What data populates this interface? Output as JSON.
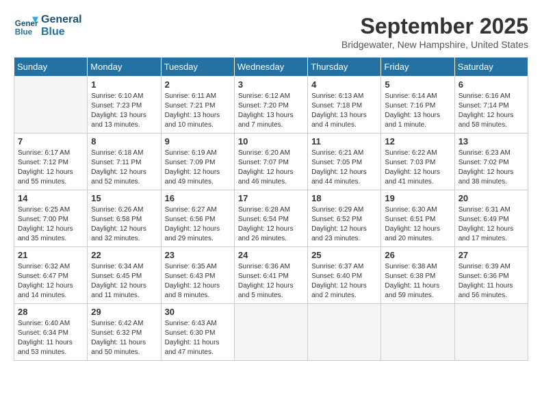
{
  "logo": {
    "line1": "General",
    "line2": "Blue"
  },
  "title": "September 2025",
  "location": "Bridgewater, New Hampshire, United States",
  "days_of_week": [
    "Sunday",
    "Monday",
    "Tuesday",
    "Wednesday",
    "Thursday",
    "Friday",
    "Saturday"
  ],
  "weeks": [
    [
      {
        "day": "",
        "info": ""
      },
      {
        "day": "1",
        "info": "Sunrise: 6:10 AM\nSunset: 7:23 PM\nDaylight: 13 hours\nand 13 minutes."
      },
      {
        "day": "2",
        "info": "Sunrise: 6:11 AM\nSunset: 7:21 PM\nDaylight: 13 hours\nand 10 minutes."
      },
      {
        "day": "3",
        "info": "Sunrise: 6:12 AM\nSunset: 7:20 PM\nDaylight: 13 hours\nand 7 minutes."
      },
      {
        "day": "4",
        "info": "Sunrise: 6:13 AM\nSunset: 7:18 PM\nDaylight: 13 hours\nand 4 minutes."
      },
      {
        "day": "5",
        "info": "Sunrise: 6:14 AM\nSunset: 7:16 PM\nDaylight: 13 hours\nand 1 minute."
      },
      {
        "day": "6",
        "info": "Sunrise: 6:16 AM\nSunset: 7:14 PM\nDaylight: 12 hours\nand 58 minutes."
      }
    ],
    [
      {
        "day": "7",
        "info": "Sunrise: 6:17 AM\nSunset: 7:12 PM\nDaylight: 12 hours\nand 55 minutes."
      },
      {
        "day": "8",
        "info": "Sunrise: 6:18 AM\nSunset: 7:11 PM\nDaylight: 12 hours\nand 52 minutes."
      },
      {
        "day": "9",
        "info": "Sunrise: 6:19 AM\nSunset: 7:09 PM\nDaylight: 12 hours\nand 49 minutes."
      },
      {
        "day": "10",
        "info": "Sunrise: 6:20 AM\nSunset: 7:07 PM\nDaylight: 12 hours\nand 46 minutes."
      },
      {
        "day": "11",
        "info": "Sunrise: 6:21 AM\nSunset: 7:05 PM\nDaylight: 12 hours\nand 44 minutes."
      },
      {
        "day": "12",
        "info": "Sunrise: 6:22 AM\nSunset: 7:03 PM\nDaylight: 12 hours\nand 41 minutes."
      },
      {
        "day": "13",
        "info": "Sunrise: 6:23 AM\nSunset: 7:02 PM\nDaylight: 12 hours\nand 38 minutes."
      }
    ],
    [
      {
        "day": "14",
        "info": "Sunrise: 6:25 AM\nSunset: 7:00 PM\nDaylight: 12 hours\nand 35 minutes."
      },
      {
        "day": "15",
        "info": "Sunrise: 6:26 AM\nSunset: 6:58 PM\nDaylight: 12 hours\nand 32 minutes."
      },
      {
        "day": "16",
        "info": "Sunrise: 6:27 AM\nSunset: 6:56 PM\nDaylight: 12 hours\nand 29 minutes."
      },
      {
        "day": "17",
        "info": "Sunrise: 6:28 AM\nSunset: 6:54 PM\nDaylight: 12 hours\nand 26 minutes."
      },
      {
        "day": "18",
        "info": "Sunrise: 6:29 AM\nSunset: 6:52 PM\nDaylight: 12 hours\nand 23 minutes."
      },
      {
        "day": "19",
        "info": "Sunrise: 6:30 AM\nSunset: 6:51 PM\nDaylight: 12 hours\nand 20 minutes."
      },
      {
        "day": "20",
        "info": "Sunrise: 6:31 AM\nSunset: 6:49 PM\nDaylight: 12 hours\nand 17 minutes."
      }
    ],
    [
      {
        "day": "21",
        "info": "Sunrise: 6:32 AM\nSunset: 6:47 PM\nDaylight: 12 hours\nand 14 minutes."
      },
      {
        "day": "22",
        "info": "Sunrise: 6:34 AM\nSunset: 6:45 PM\nDaylight: 12 hours\nand 11 minutes."
      },
      {
        "day": "23",
        "info": "Sunrise: 6:35 AM\nSunset: 6:43 PM\nDaylight: 12 hours\nand 8 minutes."
      },
      {
        "day": "24",
        "info": "Sunrise: 6:36 AM\nSunset: 6:41 PM\nDaylight: 12 hours\nand 5 minutes."
      },
      {
        "day": "25",
        "info": "Sunrise: 6:37 AM\nSunset: 6:40 PM\nDaylight: 12 hours\nand 2 minutes."
      },
      {
        "day": "26",
        "info": "Sunrise: 6:38 AM\nSunset: 6:38 PM\nDaylight: 11 hours\nand 59 minutes."
      },
      {
        "day": "27",
        "info": "Sunrise: 6:39 AM\nSunset: 6:36 PM\nDaylight: 11 hours\nand 56 minutes."
      }
    ],
    [
      {
        "day": "28",
        "info": "Sunrise: 6:40 AM\nSunset: 6:34 PM\nDaylight: 11 hours\nand 53 minutes."
      },
      {
        "day": "29",
        "info": "Sunrise: 6:42 AM\nSunset: 6:32 PM\nDaylight: 11 hours\nand 50 minutes."
      },
      {
        "day": "30",
        "info": "Sunrise: 6:43 AM\nSunset: 6:30 PM\nDaylight: 11 hours\nand 47 minutes."
      },
      {
        "day": "",
        "info": ""
      },
      {
        "day": "",
        "info": ""
      },
      {
        "day": "",
        "info": ""
      },
      {
        "day": "",
        "info": ""
      }
    ]
  ]
}
